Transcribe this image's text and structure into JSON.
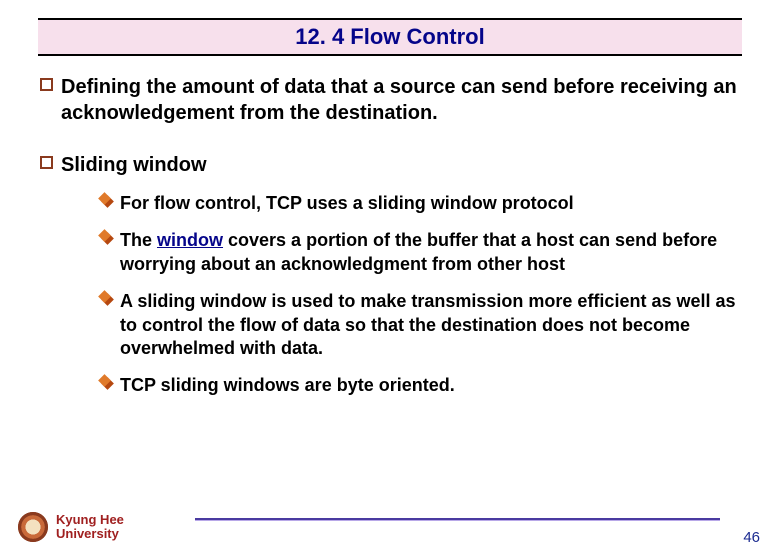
{
  "title": "12. 4 Flow Control",
  "bullets": {
    "b1": "Defining the amount of data that a source can send before receiving an acknowledgement from the destination.",
    "b2": "Sliding window"
  },
  "sub": {
    "s1_pre": " For flow control, TCP uses a sliding window protocol",
    "s2_pre": " The ",
    "s2_window": "window",
    "s2_post": " covers a portion of the buffer that a host can send before worrying about an acknowledgment from other host",
    "s3": "A sliding window is used to make transmission more efficient as well as to control the flow of data so that the destination does not become overwhelmed with data.",
    "s4": "TCP sliding windows are byte oriented."
  },
  "footer": {
    "university_line1": "Kyung Hee",
    "university_line2": "University",
    "page": "46"
  }
}
